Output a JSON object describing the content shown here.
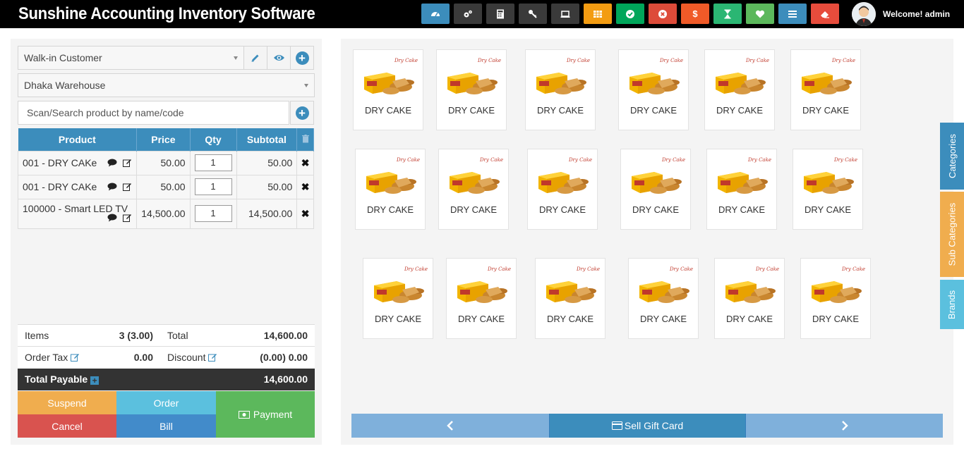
{
  "header": {
    "title": "Sunshine Accounting Inventory Software",
    "welcome": "Welcome! admin",
    "toolbar": [
      {
        "icon": "dashboard-icon",
        "color": "#3c8dbc",
        "glyph": ""
      },
      {
        "icon": "cogs-icon",
        "color": "#3a3a3a",
        "glyph": ""
      },
      {
        "icon": "calculator-icon",
        "color": "#3a3a3a",
        "glyph": ""
      },
      {
        "icon": "key-icon",
        "color": "#3a3a3a",
        "glyph": ""
      },
      {
        "icon": "laptop-icon",
        "color": "#3a3a3a",
        "glyph": ""
      },
      {
        "icon": "table-icon",
        "color": "#f39c12",
        "glyph": ""
      },
      {
        "icon": "check-circle-icon",
        "color": "#00a65a",
        "glyph": ""
      },
      {
        "icon": "times-circle-icon",
        "color": "#dd4b39",
        "glyph": ""
      },
      {
        "icon": "dollar-icon",
        "color": "#f05a28",
        "glyph": "$"
      },
      {
        "icon": "hourglass-icon",
        "color": "#2bb673",
        "glyph": ""
      },
      {
        "icon": "heart-icon",
        "color": "#5cb85c",
        "glyph": ""
      },
      {
        "icon": "list-icon",
        "color": "#3c8dbc",
        "glyph": ""
      },
      {
        "icon": "eraser-icon",
        "color": "#e74c3c",
        "glyph": ""
      }
    ]
  },
  "order": {
    "customer": "Walk-in Customer",
    "warehouse": "Dhaka Warehouse",
    "search_placeholder": "Scan/Search product by name/code",
    "columns": [
      "Product",
      "Price",
      "Qty",
      "Subtotal"
    ],
    "items": [
      {
        "product": "001 - DRY CAKe",
        "price": "50.00",
        "qty": "1",
        "subtotal": "50.00"
      },
      {
        "product": "001 - DRY CAKe",
        "price": "50.00",
        "qty": "1",
        "subtotal": "50.00"
      },
      {
        "product": "100000 - Smart LED TV",
        "price": "14,500.00",
        "qty": "1",
        "subtotal": "14,500.00"
      }
    ],
    "totals": {
      "items_label": "Items",
      "items_value": "3 (3.00)",
      "total_label": "Total",
      "total_value": "14,600.00",
      "tax_label": "Order Tax",
      "tax_value": "0.00",
      "discount_label": "Discount",
      "discount_value": "(0.00) 0.00",
      "payable_label": "Total Payable",
      "payable_value": "14,600.00"
    },
    "buttons": {
      "suspend": "Suspend",
      "order": "Order",
      "payment": "Payment",
      "cancel": "Cancel",
      "bill": "Bill"
    }
  },
  "products": {
    "rows": [
      [
        "DRY CAKE",
        "DRY CAKE",
        "DRY CAKE",
        "DRY CAKE",
        "DRY CAKE",
        "DRY CAKE"
      ],
      [
        "DRY CAKE",
        "DRY CAKE",
        "DRY CAKE",
        "DRY CAKE",
        "DRY CAKE",
        "DRY CAKE"
      ],
      [
        "DRY CAKE",
        "DRY CAKE",
        "DRY CAKE",
        "DRY CAKE",
        "DRY CAKE",
        "DRY CAKE"
      ]
    ],
    "image_label": "Dry Cake"
  },
  "pagination": {
    "gift_card": "Sell Gift Card"
  },
  "side_tabs": [
    "Categories",
    "Sub Categories",
    "Brands"
  ],
  "colors": {
    "primary": "#3c8dbc",
    "warning": "#f0ad4e",
    "info": "#5bc0de",
    "danger": "#d9534f",
    "success": "#5cb85c",
    "dark": "#333333"
  }
}
